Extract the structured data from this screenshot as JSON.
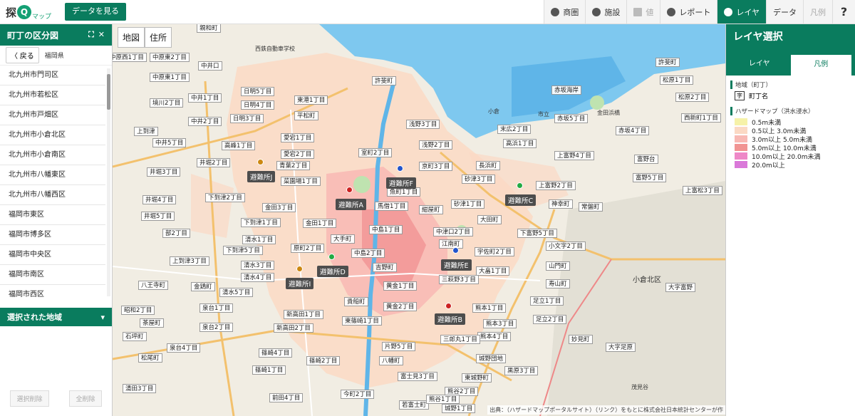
{
  "app": {
    "logo_main": "探",
    "logo_q": "Q",
    "logo_sub": "マップ",
    "view_data_label": "データを見る"
  },
  "toolbar": {
    "items": [
      {
        "label": "商圏",
        "icon": "circle-icon",
        "state": "normal"
      },
      {
        "label": "施設",
        "icon": "pin-icon",
        "state": "normal"
      },
      {
        "label": "値",
        "icon": "table-icon",
        "state": "dim"
      },
      {
        "label": "レポート",
        "icon": "pie-icon",
        "state": "normal"
      },
      {
        "label": "レイヤ",
        "icon": "layers-icon",
        "state": "active"
      },
      {
        "label": "データ",
        "icon": "",
        "state": "normal"
      },
      {
        "label": "凡例",
        "icon": "",
        "state": "dim"
      }
    ],
    "help": "?"
  },
  "left_panel": {
    "title": "町丁の区分図",
    "back_label": "戻る",
    "breadcrumb": "福岡県",
    "regions": [
      "北九州市門司区",
      "北九州市若松区",
      "北九州市戸畑区",
      "北九州市小倉北区",
      "北九州市小倉南区",
      "北九州市八幡東区",
      "北九州市八幡西区",
      "福岡市東区",
      "福岡市博多区",
      "福岡市中央区",
      "福岡市南区",
      "福岡市西区"
    ],
    "selected_title": "選択された地域",
    "clear_selected": "選択削除",
    "clear_all": "全削除"
  },
  "map": {
    "tabs": [
      "地図",
      "住所"
    ],
    "town_labels": [
      "親和町",
      "中原西1丁目",
      "中原東2丁目",
      "中井口",
      "中原東1丁目",
      "中井1丁目",
      "日明5丁目",
      "東港1丁目",
      "境川2丁目",
      "日明4丁目",
      "平松町",
      "中井2丁目",
      "日明3丁目",
      "浅野3丁目",
      "上到津",
      "愛宕1丁目",
      "中井5丁目",
      "高峰1丁目",
      "愛宕2丁目",
      "室町2丁目",
      "浅野2丁目",
      "井堀2丁目",
      "青葉2丁目",
      "京町3丁目",
      "井堀3丁目",
      "菜園場1丁目",
      "砂津3丁目",
      "下到津2丁目",
      "魚町1丁目",
      "紺屋町",
      "金田3丁目",
      "馬借1丁目",
      "砂津1丁目",
      "下到津1丁目",
      "金田1丁目",
      "大手町",
      "中島1丁目",
      "中津口2丁目",
      "清水1丁目",
      "原町2丁目",
      "下到津5丁目",
      "中島2丁目",
      "江南町",
      "宇佐町2丁目",
      "清水3丁目",
      "吉野町",
      "清水4丁目",
      "三萩野3丁目",
      "清水5丁目",
      "黄金1丁目",
      "貴船町",
      "熊本1丁目",
      "黄金2丁目",
      "新高田1丁目",
      "熊本3丁目",
      "東篠崎1丁目",
      "熊本4丁目",
      "新高田2丁目",
      "片野5丁目",
      "三郎丸1丁目",
      "城野団地",
      "篠崎2丁目",
      "八幡町",
      "富士見3丁目",
      "黒原3丁目",
      "熊谷2丁目",
      "東城野町",
      "若富士町",
      "城野1丁目",
      "許斐町",
      "末広2丁目",
      "高浜1丁目",
      "上富野4丁目",
      "上富野2丁目",
      "神幸町",
      "常盤町",
      "長浜町",
      "大田町",
      "下富野5丁目",
      "小文字2丁目",
      "山門町",
      "寿山町",
      "足立1丁目",
      "足立2丁目",
      "妙見町",
      "大字富野",
      "大字足原",
      "赤坂海岸",
      "赤坂5丁目",
      "赤坂4丁目",
      "富野台",
      "松原1丁目",
      "松原2丁目",
      "西新町1丁目",
      "上富松3丁目",
      "許斐町",
      "大畠1丁目",
      "富野5丁目",
      "井堀4丁目",
      "井堀5丁目",
      "部2丁目",
      "上到津3丁目",
      "八王寺町",
      "昭和2丁目",
      "茶屋町",
      "金鶏町",
      "泉台1丁目",
      "泉台2丁目",
      "石坪町",
      "泉台4丁目",
      "松尾町",
      "篠崎4丁目",
      "篠崎1丁目",
      "清田3丁目",
      "前田4丁目",
      "今町2丁目",
      "熊谷1丁目"
    ],
    "shelters": [
      {
        "label": "避難所A",
        "color": "#cc2222"
      },
      {
        "label": "避難所B",
        "color": "#cc2222"
      },
      {
        "label": "避難所C",
        "color": "#22aa44"
      },
      {
        "label": "避難所D",
        "color": "#22aa44"
      },
      {
        "label": "避難所E",
        "color": "#2255cc"
      },
      {
        "label": "避難所F",
        "color": "#2255cc"
      },
      {
        "label": "避難所I",
        "color": "#cc8811"
      },
      {
        "label": "避難所J",
        "color": "#cc8811"
      }
    ],
    "area_label": "小倉北区",
    "place_labels": [
      "西鉄自動車学校",
      "小倉",
      "市立",
      "金田浜橋",
      "茂見谷"
    ],
    "attribution": "出典：（ハザードマップポータルサイト）（リンク）をもとに株式会社日本統計センターが作"
  },
  "right_panel": {
    "title": "レイヤ選択",
    "tabs": [
      "レイヤ",
      "凡例"
    ],
    "area_title": "地域（町丁）",
    "town_key_box": "字",
    "town_key_label": "町丁名",
    "hazard_title": "ハザードマップ（洪水浸水）",
    "legend": [
      {
        "label": "0.5m未満",
        "color": "#f6f2a8"
      },
      {
        "label": "0.5以上 3.0m未満",
        "color": "#fbd9c4"
      },
      {
        "label": "3.0m以上 5.0m未満",
        "color": "#f8b9b4"
      },
      {
        "label": "5.0m以上 10.0m未満",
        "color": "#f19493"
      },
      {
        "label": "10.0m以上 20.0m未満",
        "color": "#ee88c7"
      },
      {
        "label": "20.0m以上",
        "color": "#da79d9"
      }
    ]
  }
}
